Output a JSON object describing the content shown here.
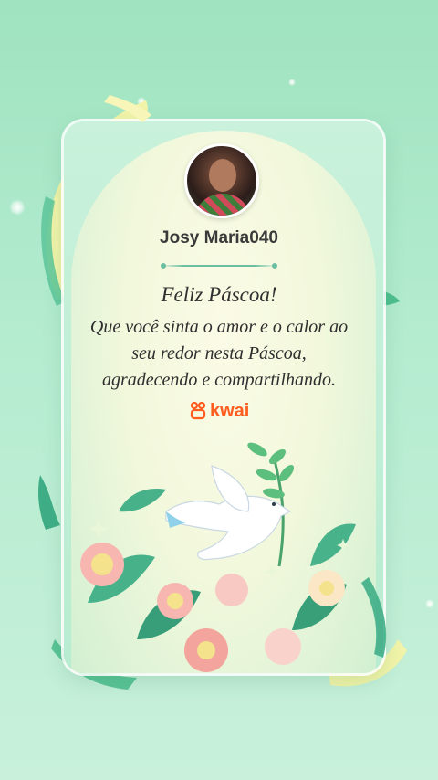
{
  "profile": {
    "username": "Josy Maria040"
  },
  "card": {
    "title": "Feliz Páscoa!",
    "message_lines": [
      "Que você sinta o amor e o calor ao",
      "seu redor nesta Páscoa,",
      "agradecendo e compartilhando."
    ]
  },
  "brand": {
    "name": "kwai",
    "color": "#ff5c1f"
  },
  "theme": {
    "background": "#a8e6c4",
    "accent": "#6bbfa0",
    "ribbon_yellow": "#f4f3a6"
  },
  "decorations": {
    "illustration": "dove-with-olive-branch-icon",
    "flowers": "flower-icon"
  }
}
